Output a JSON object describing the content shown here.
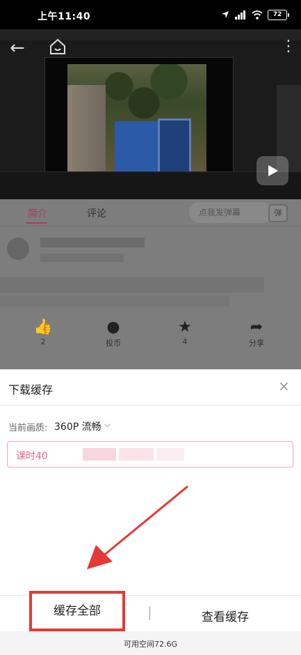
{
  "status_bar": {
    "time": "上午11:40",
    "battery": "72"
  },
  "intro_tabs": {
    "intro": "简介",
    "comment": "评论",
    "danmaku_placeholder": "点我发弹幕",
    "danmaku_icon": "弹"
  },
  "actions": [
    {
      "icon": "thumb-up-icon",
      "label": "2"
    },
    {
      "icon": "coin-icon",
      "label": "投币"
    },
    {
      "icon": "star-icon",
      "label": "4"
    },
    {
      "icon": "share-icon",
      "label": "分享"
    }
  ],
  "sheet": {
    "title": "下载缓存",
    "close": "×",
    "quality_label": "当前画质:",
    "quality_value": "360P 流畅",
    "item_text": "课时40",
    "cache_all": "缓存全部",
    "view_cache": "查看缓存",
    "available_space": "可用空间72.6G"
  },
  "colors": {
    "accent": "#e8688a",
    "highlight_box": "#e53935",
    "arrow": "#e53935"
  }
}
